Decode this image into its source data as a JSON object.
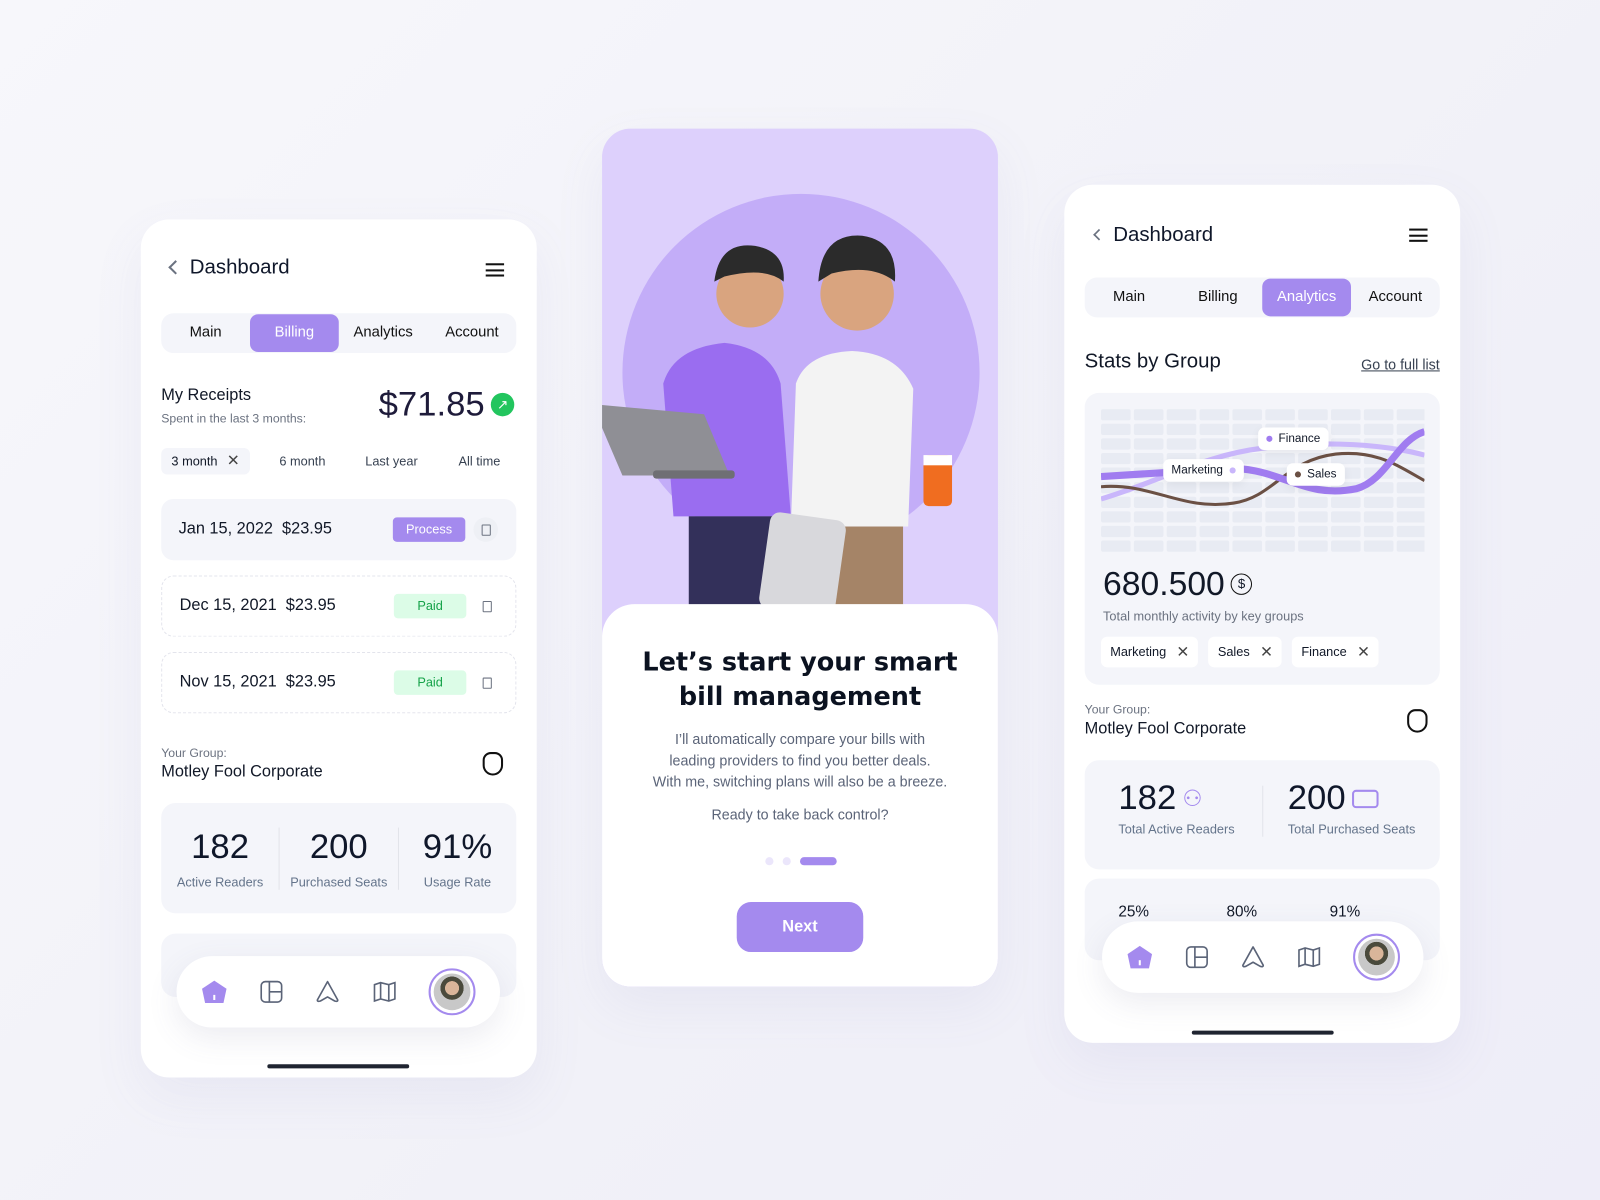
{
  "left": {
    "header": {
      "title": "Dashboard"
    },
    "tabs": [
      {
        "label": "Main"
      },
      {
        "label": "Billing",
        "active": true
      },
      {
        "label": "Analytics"
      },
      {
        "label": "Account"
      }
    ],
    "receipts": {
      "title": "My Receipts",
      "subtitle": "Spent in the last 3 months:",
      "amount": "$71.85",
      "trend": "up"
    },
    "filters": [
      {
        "label": "3 month",
        "active": true
      },
      {
        "label": "6 month"
      },
      {
        "label": "Last year"
      },
      {
        "label": "All time"
      }
    ],
    "rows": [
      {
        "date": "Jan 15, 2022",
        "amount": "$23.95",
        "status": "Process"
      },
      {
        "date": "Dec 15, 2021",
        "amount": "$23.95",
        "status": "Paid"
      },
      {
        "date": "Nov 15, 2021",
        "amount": "$23.95",
        "status": "Paid"
      }
    ],
    "group": {
      "label": "Your Group:",
      "name": "Motley Fool Corporate"
    },
    "stats": [
      {
        "value": "182",
        "label": "Active Readers"
      },
      {
        "value": "200",
        "label": "Purchased Seats"
      },
      {
        "value": "91%",
        "label": "Usage Rate"
      }
    ]
  },
  "middle": {
    "title_line1": "Let’s start your smart",
    "title_line2": "bill management",
    "body_lines": [
      "I’ll automatically compare your bills with",
      "leading providers to find you better deals.",
      "With me, switching plans will also be a breeze."
    ],
    "prompt": "Ready to take back control?",
    "pager": {
      "total": 3,
      "current": 3
    },
    "next_label": "Next"
  },
  "right": {
    "header": {
      "title": "Dashboard"
    },
    "tabs": [
      {
        "label": "Main"
      },
      {
        "label": "Billing"
      },
      {
        "label": "Analytics",
        "active": true
      },
      {
        "label": "Account"
      }
    ],
    "section_title": "Stats by Group",
    "full_list_link": "Go to full list",
    "chart": {
      "series": [
        {
          "name": "Finance",
          "color": "#c9b6fb"
        },
        {
          "name": "Marketing",
          "color": "#a07cf0"
        },
        {
          "name": "Sales",
          "color": "#6b5044"
        }
      ]
    },
    "total": "680.500",
    "total_caption": "Total monthly activity by key groups",
    "chips": [
      "Marketing",
      "Sales",
      "Finance"
    ],
    "group": {
      "label": "Your Group:",
      "name": "Motley Fool Corporate"
    },
    "stats": [
      {
        "value": "182",
        "label": "Total Active Readers",
        "icon": "users-icon"
      },
      {
        "value": "200",
        "label": "Total Purchased Seats",
        "icon": "ticket-icon"
      }
    ],
    "rates": [
      "25%",
      "80%",
      "91%"
    ]
  },
  "colors": {
    "accent": "#a48aee",
    "success": "#22c55e",
    "paid_bg": "#dcfce7",
    "paid_text": "#16a34a",
    "illustration_bg": "#ddd0fc"
  }
}
